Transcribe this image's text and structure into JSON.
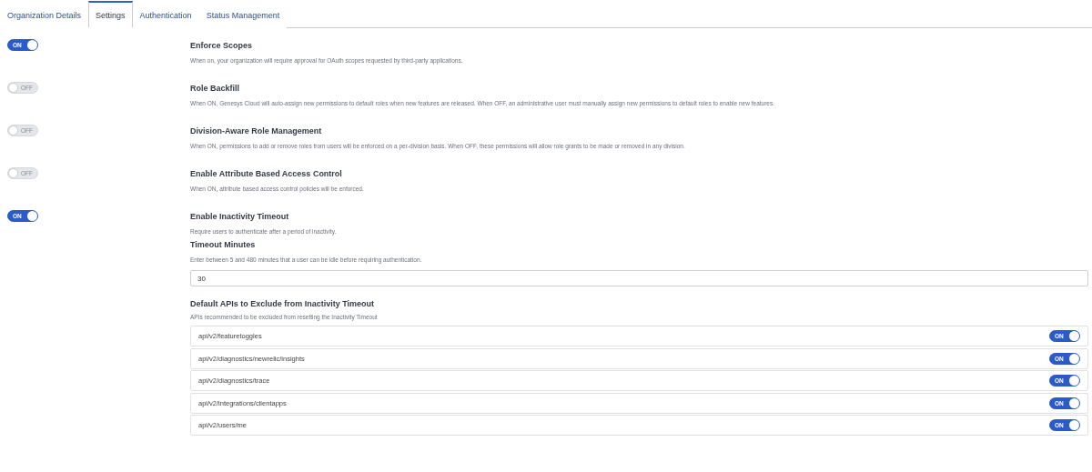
{
  "tabs": [
    {
      "label": "Organization Details",
      "selected": false
    },
    {
      "label": "Settings",
      "selected": true
    },
    {
      "label": "Authentication",
      "selected": false
    },
    {
      "label": "Status Management",
      "selected": false
    }
  ],
  "settings": [
    {
      "title": "Enforce Scopes",
      "description": "When on, your organization will require approval for OAuth scopes requested by third-party applications.",
      "on": true,
      "toggle_label": "ON"
    },
    {
      "title": "Role Backfill",
      "description": "When ON, Genesys Cloud will auto-assign new permissions to default roles when new features are released. When OFF, an administrative user must manually assign new permissions to default roles to enable new features.",
      "on": false,
      "toggle_label": "OFF"
    },
    {
      "title": "Division-Aware Role Management",
      "description": "When ON, permissions to add or remove roles from users will be enforced on a per-division basis. When OFF, these permissions will allow role grants to be made or removed in any division.",
      "on": false,
      "toggle_label": "OFF"
    },
    {
      "title": "Enable Attribute Based Access Control",
      "description": "When ON, attribute based access control policies will be enforced.",
      "on": false,
      "toggle_label": "OFF"
    },
    {
      "title": "Enable Inactivity Timeout",
      "description": "Require users to authenticate after a period of inactivity.",
      "on": true,
      "toggle_label": "ON"
    }
  ],
  "timeout": {
    "title": "Timeout Minutes",
    "description": "Enter between 5 and 480 minutes that a user can be idle before requiring authentication.",
    "value": "30"
  },
  "excluded_apis": {
    "title": "Default APIs to Exclude from Inactivity Timeout",
    "description": "APIs recommended to be excluded from resetting the Inactivity Timeout",
    "items": [
      {
        "path": "api/v2/featuretoggles",
        "on": true,
        "toggle_label": "ON"
      },
      {
        "path": "api/v2/diagnostics/newrelic/insights",
        "on": true,
        "toggle_label": "ON"
      },
      {
        "path": "api/v2/diagnostics/trace",
        "on": true,
        "toggle_label": "ON"
      },
      {
        "path": "api/v2/integrations/clientapps",
        "on": true,
        "toggle_label": "ON"
      },
      {
        "path": "api/v2/users/me",
        "on": true,
        "toggle_label": "ON"
      }
    ]
  }
}
